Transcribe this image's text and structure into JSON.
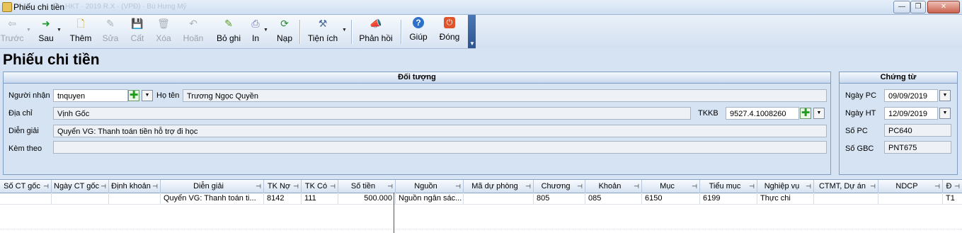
{
  "window": {
    "title": "Phiếu chi tiền",
    "blurred_caption": "HKT · 2019 R.X · (VPĐ) · Bù Hưng Mỹ",
    "minimize_glyph": "—",
    "maximize_glyph": "❐",
    "close_glyph": "✕"
  },
  "toolbar": {
    "items": [
      {
        "label": "Trước",
        "icon": "arrow-left-icon",
        "glyph": "⇦",
        "enabled": false
      },
      {
        "label": "Sau",
        "icon": "arrow-right-icon",
        "glyph": "➜",
        "enabled": true
      },
      {
        "label": "Thêm",
        "icon": "add-document-icon",
        "glyph": "🗋",
        "enabled": true
      },
      {
        "label": "Sửa",
        "icon": "edit-document-icon",
        "glyph": "✎",
        "enabled": false
      },
      {
        "label": "Cất",
        "icon": "save-icon",
        "glyph": "💾",
        "enabled": false
      },
      {
        "label": "Xóa",
        "icon": "delete-document-icon",
        "glyph": "🗑",
        "enabled": false
      },
      {
        "label": "Hoãn",
        "icon": "undo-icon",
        "glyph": "↶",
        "enabled": false
      },
      {
        "label": "Bỏ ghi",
        "icon": "unpost-icon",
        "glyph": "✎",
        "enabled": true
      },
      {
        "label": "In",
        "icon": "print-icon",
        "glyph": "⎙",
        "enabled": true
      },
      {
        "label": "Nạp",
        "icon": "reload-icon",
        "glyph": "⟳",
        "enabled": true
      },
      {
        "label": "Tiện ích",
        "icon": "tools-icon",
        "glyph": "⚒",
        "enabled": true
      },
      {
        "label": "Phản hồi",
        "icon": "megaphone-icon",
        "glyph": "📣",
        "enabled": true
      },
      {
        "label": "Giúp",
        "icon": "help-icon",
        "glyph": "?",
        "enabled": true
      },
      {
        "label": "Đóng",
        "icon": "close-icon",
        "glyph": "⏻",
        "enabled": true
      }
    ],
    "dropdown_glyph": "▼"
  },
  "page_title": "Phiếu chi tiền",
  "doi_tuong": {
    "heading": "Đối tượng",
    "nguoi_nhan_label": "Người nhận",
    "nguoi_nhan_value": "tnquyen",
    "ho_ten_label": "Họ tên",
    "ho_ten_value": "Trương Ngọc Quyền",
    "dia_chi_label": "Địa chỉ",
    "dia_chi_value": "Vịnh Gốc",
    "tkkb_label": "TKKB",
    "tkkb_value": "9527.4.1008260",
    "dien_giai_label": "Diễn giải",
    "dien_giai_value": "Quyển VG: Thanh toán tiền hỗ trợ đi học",
    "kem_theo_label": "Kèm theo",
    "kem_theo_value": "",
    "plus_glyph": "✚",
    "dropdown_glyph": "▼"
  },
  "chung_tu": {
    "heading": "Chứng từ",
    "ngay_pc_label": "Ngày PC",
    "ngay_pc_value": "09/09/2019",
    "ngay_ht_label": "Ngày HT",
    "ngay_ht_value": "12/09/2019",
    "so_pc_label": "Số PC",
    "so_pc_value": "PC640",
    "so_gbc_label": "Số GBC",
    "so_gbc_value": "PNT675"
  },
  "grid": {
    "pin_glyph": "⊣",
    "columns": [
      "Số CT gốc",
      "Ngày CT gốc",
      "Định khoản",
      "Diễn giải",
      "TK Nợ",
      "TK Có",
      "Số tiền",
      "Nguồn",
      "Mã dự phòng",
      "Chương",
      "Khoản",
      "Mục",
      "Tiểu mục",
      "Nghiệp vụ",
      "CTMT, Dự án",
      "NDCP",
      "Đ"
    ],
    "rows": [
      [
        "",
        "",
        "",
        "Quyển VG: Thanh toán ti...",
        "8142",
        "111",
        "500.000",
        "Nguồn ngân sác...",
        "",
        "805",
        "085",
        "6150",
        "6199",
        "Thực chi",
        "",
        "",
        "T1"
      ]
    ]
  }
}
